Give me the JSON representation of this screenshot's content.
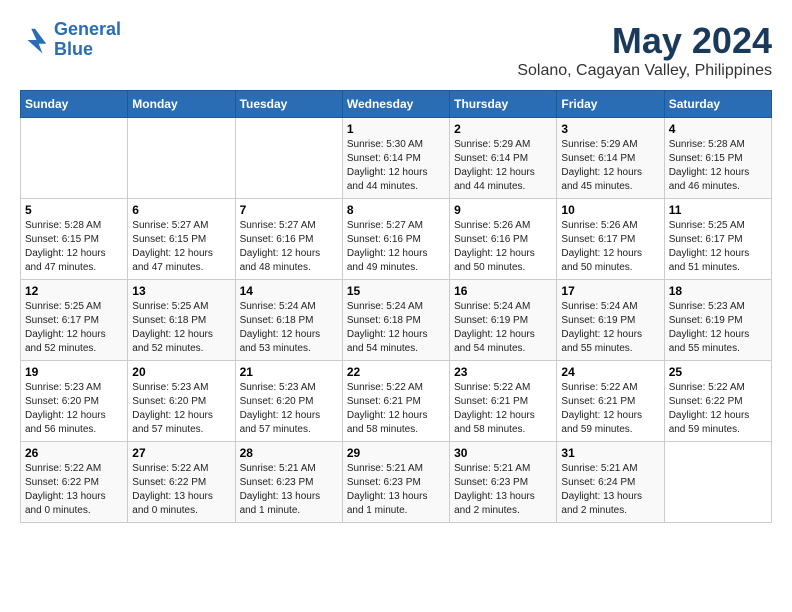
{
  "header": {
    "logo_line1": "General",
    "logo_line2": "Blue",
    "month_title": "May 2024",
    "subtitle": "Solano, Cagayan Valley, Philippines"
  },
  "days_of_week": [
    "Sunday",
    "Monday",
    "Tuesday",
    "Wednesday",
    "Thursday",
    "Friday",
    "Saturday"
  ],
  "weeks": [
    [
      {
        "day": "",
        "info": ""
      },
      {
        "day": "",
        "info": ""
      },
      {
        "day": "",
        "info": ""
      },
      {
        "day": "1",
        "info": "Sunrise: 5:30 AM\nSunset: 6:14 PM\nDaylight: 12 hours\nand 44 minutes."
      },
      {
        "day": "2",
        "info": "Sunrise: 5:29 AM\nSunset: 6:14 PM\nDaylight: 12 hours\nand 44 minutes."
      },
      {
        "day": "3",
        "info": "Sunrise: 5:29 AM\nSunset: 6:14 PM\nDaylight: 12 hours\nand 45 minutes."
      },
      {
        "day": "4",
        "info": "Sunrise: 5:28 AM\nSunset: 6:15 PM\nDaylight: 12 hours\nand 46 minutes."
      }
    ],
    [
      {
        "day": "5",
        "info": "Sunrise: 5:28 AM\nSunset: 6:15 PM\nDaylight: 12 hours\nand 47 minutes."
      },
      {
        "day": "6",
        "info": "Sunrise: 5:27 AM\nSunset: 6:15 PM\nDaylight: 12 hours\nand 47 minutes."
      },
      {
        "day": "7",
        "info": "Sunrise: 5:27 AM\nSunset: 6:16 PM\nDaylight: 12 hours\nand 48 minutes."
      },
      {
        "day": "8",
        "info": "Sunrise: 5:27 AM\nSunset: 6:16 PM\nDaylight: 12 hours\nand 49 minutes."
      },
      {
        "day": "9",
        "info": "Sunrise: 5:26 AM\nSunset: 6:16 PM\nDaylight: 12 hours\nand 50 minutes."
      },
      {
        "day": "10",
        "info": "Sunrise: 5:26 AM\nSunset: 6:17 PM\nDaylight: 12 hours\nand 50 minutes."
      },
      {
        "day": "11",
        "info": "Sunrise: 5:25 AM\nSunset: 6:17 PM\nDaylight: 12 hours\nand 51 minutes."
      }
    ],
    [
      {
        "day": "12",
        "info": "Sunrise: 5:25 AM\nSunset: 6:17 PM\nDaylight: 12 hours\nand 52 minutes."
      },
      {
        "day": "13",
        "info": "Sunrise: 5:25 AM\nSunset: 6:18 PM\nDaylight: 12 hours\nand 52 minutes."
      },
      {
        "day": "14",
        "info": "Sunrise: 5:24 AM\nSunset: 6:18 PM\nDaylight: 12 hours\nand 53 minutes."
      },
      {
        "day": "15",
        "info": "Sunrise: 5:24 AM\nSunset: 6:18 PM\nDaylight: 12 hours\nand 54 minutes."
      },
      {
        "day": "16",
        "info": "Sunrise: 5:24 AM\nSunset: 6:19 PM\nDaylight: 12 hours\nand 54 minutes."
      },
      {
        "day": "17",
        "info": "Sunrise: 5:24 AM\nSunset: 6:19 PM\nDaylight: 12 hours\nand 55 minutes."
      },
      {
        "day": "18",
        "info": "Sunrise: 5:23 AM\nSunset: 6:19 PM\nDaylight: 12 hours\nand 55 minutes."
      }
    ],
    [
      {
        "day": "19",
        "info": "Sunrise: 5:23 AM\nSunset: 6:20 PM\nDaylight: 12 hours\nand 56 minutes."
      },
      {
        "day": "20",
        "info": "Sunrise: 5:23 AM\nSunset: 6:20 PM\nDaylight: 12 hours\nand 57 minutes."
      },
      {
        "day": "21",
        "info": "Sunrise: 5:23 AM\nSunset: 6:20 PM\nDaylight: 12 hours\nand 57 minutes."
      },
      {
        "day": "22",
        "info": "Sunrise: 5:22 AM\nSunset: 6:21 PM\nDaylight: 12 hours\nand 58 minutes."
      },
      {
        "day": "23",
        "info": "Sunrise: 5:22 AM\nSunset: 6:21 PM\nDaylight: 12 hours\nand 58 minutes."
      },
      {
        "day": "24",
        "info": "Sunrise: 5:22 AM\nSunset: 6:21 PM\nDaylight: 12 hours\nand 59 minutes."
      },
      {
        "day": "25",
        "info": "Sunrise: 5:22 AM\nSunset: 6:22 PM\nDaylight: 12 hours\nand 59 minutes."
      }
    ],
    [
      {
        "day": "26",
        "info": "Sunrise: 5:22 AM\nSunset: 6:22 PM\nDaylight: 13 hours\nand 0 minutes."
      },
      {
        "day": "27",
        "info": "Sunrise: 5:22 AM\nSunset: 6:22 PM\nDaylight: 13 hours\nand 0 minutes."
      },
      {
        "day": "28",
        "info": "Sunrise: 5:21 AM\nSunset: 6:23 PM\nDaylight: 13 hours\nand 1 minute."
      },
      {
        "day": "29",
        "info": "Sunrise: 5:21 AM\nSunset: 6:23 PM\nDaylight: 13 hours\nand 1 minute."
      },
      {
        "day": "30",
        "info": "Sunrise: 5:21 AM\nSunset: 6:23 PM\nDaylight: 13 hours\nand 2 minutes."
      },
      {
        "day": "31",
        "info": "Sunrise: 5:21 AM\nSunset: 6:24 PM\nDaylight: 13 hours\nand 2 minutes."
      },
      {
        "day": "",
        "info": ""
      }
    ]
  ]
}
